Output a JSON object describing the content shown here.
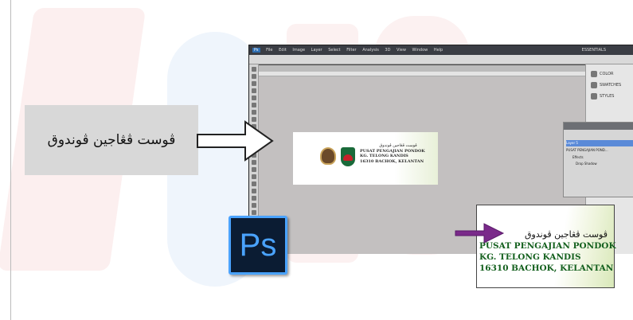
{
  "callout": {
    "label": "ڤوست ڤڠاجين ڤوندوق"
  },
  "photoshop": {
    "menu": [
      "Ps",
      "File",
      "Edit",
      "Image",
      "Layer",
      "Select",
      "Filter",
      "Analysis",
      "3D",
      "View",
      "Window",
      "Help"
    ],
    "workspace": "ESSENTIALS",
    "right_panels": [
      "COLOR",
      "SWATCHES",
      "STYLES"
    ],
    "layers": [
      "Layer 5",
      "PUSAT PENGAJIAN POND...",
      "Effects",
      "Drop Shadow"
    ]
  },
  "letterhead": {
    "arabic": "ڤوست ڤڠاجين ڤوندوق",
    "line1": "PUSAT PENGAJIAN PONDOK",
    "line2": "KG. TELONG KANDIS",
    "line3": "16310 BACHOK, KELANTAN"
  },
  "ps_logo": "Ps",
  "colors": {
    "zoom_text": "#14601e",
    "purple_arrow": "#7a2a8a",
    "ps_logo_bg": "#0b1c33",
    "ps_logo_fg": "#4aa3ff"
  }
}
